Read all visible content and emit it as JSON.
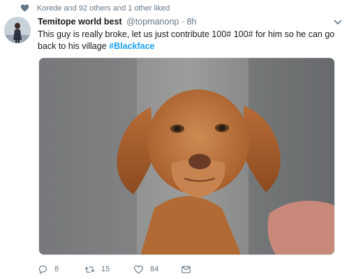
{
  "social_context": {
    "icon": "heart-icon",
    "text": "Korede and 92 others and 1 other liked"
  },
  "tweet": {
    "author_name": "Temitope world best",
    "handle": "@topmanonp",
    "separator": "·",
    "time": "8h",
    "text_main": "This guy is really broke, let us just contribute 100# 100# for him so he can go back to his village ",
    "hashtag": "#Blackface",
    "media": {
      "description_icon": "puppy-photo"
    }
  },
  "actions": {
    "reply_count": "8",
    "retweet_count": "15",
    "like_count": "84"
  },
  "colors": {
    "link": "#1da1f2",
    "muted": "#657786",
    "text": "#14171a"
  }
}
